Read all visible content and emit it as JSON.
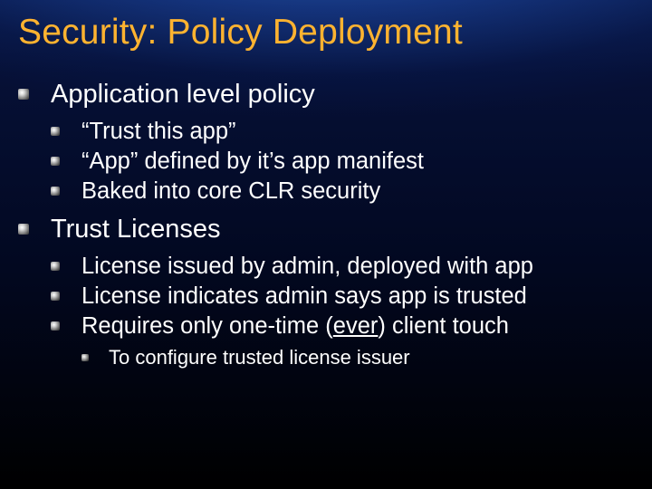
{
  "title": "Security:  Policy Deployment",
  "bullets": [
    {
      "text": "Application level policy",
      "children": [
        {
          "text": "“Trust this app”"
        },
        {
          "text": "“App” defined by it’s app manifest"
        },
        {
          "text": "Baked into core CLR security"
        }
      ]
    },
    {
      "text": "Trust Licenses",
      "children": [
        {
          "text": "License issued by admin, deployed with app"
        },
        {
          "text": "License indicates admin says app is trusted"
        },
        {
          "text_pre": "Requires only one-time (",
          "text_underlined": "ever",
          "text_post": ") client touch",
          "children": [
            {
              "text": "To configure trusted license issuer"
            }
          ]
        }
      ]
    }
  ]
}
